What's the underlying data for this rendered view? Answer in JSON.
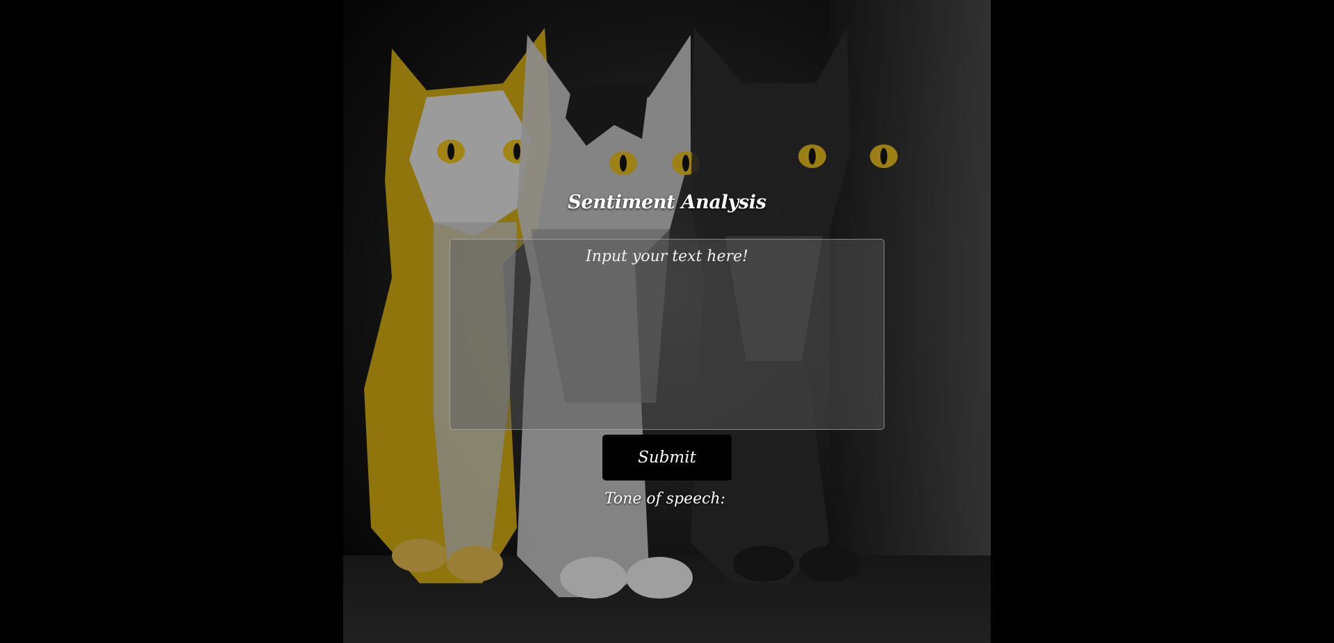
{
  "header": {
    "title": "Sentiment Analysis"
  },
  "form": {
    "text_placeholder": "Input your text here!",
    "text_value": "",
    "submit_label": "Submit"
  },
  "result": {
    "label": "Tone of speech:",
    "value": ""
  },
  "background": {
    "image": "three-kittens-artwork",
    "colors": {
      "page": "#000000",
      "kitten_yellow": "#d8a90e",
      "eye_yellow": "#e2b91a"
    }
  }
}
